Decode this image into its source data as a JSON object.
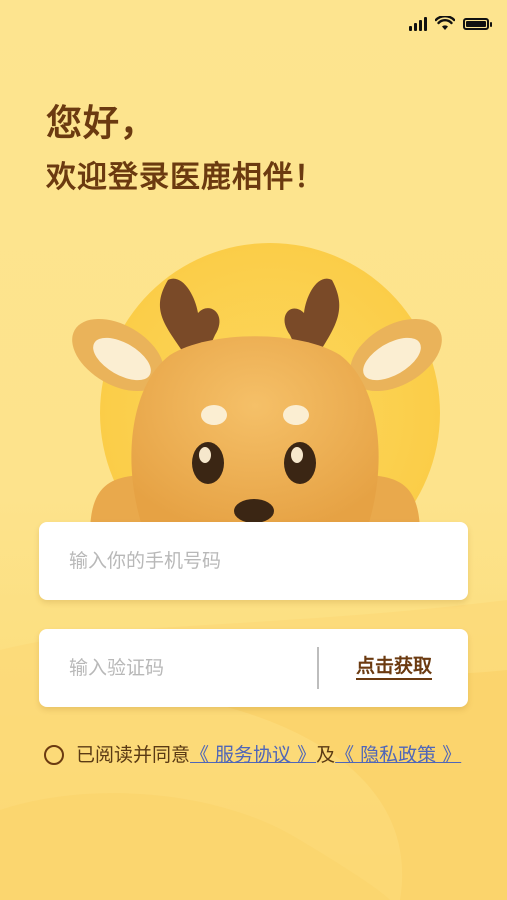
{
  "status_bar": {
    "signal": "signal-icon",
    "wifi": "wifi-icon",
    "battery": "battery-icon"
  },
  "greeting": {
    "line1": "您好，",
    "line2": "欢迎登录医鹿相伴！"
  },
  "mascot": "deer-mascot",
  "phone_input": {
    "placeholder": "输入你的手机号码",
    "value": ""
  },
  "code_input": {
    "placeholder": "输入验证码",
    "value": ""
  },
  "get_code_label": "点击获取",
  "agreement": {
    "prefix": "已阅读并同意",
    "service_link": "《 服务协议 》",
    "joiner": "及",
    "privacy_link": "《 隐私政策 》"
  },
  "colors": {
    "background": "#fde48f",
    "heading": "#6b3a10",
    "link": "#4f66b8",
    "sun": "#fbd35a"
  }
}
